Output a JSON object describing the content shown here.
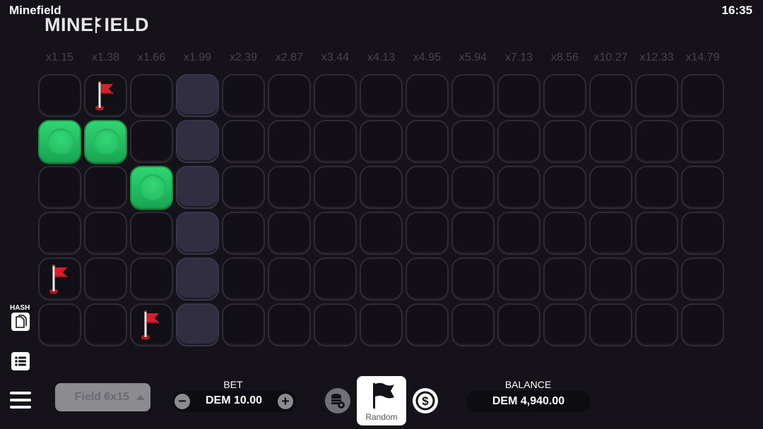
{
  "app": {
    "title": "Minefield",
    "clock": "16:35",
    "logo_left": "MINE",
    "logo_right": "IELD"
  },
  "multipliers": [
    "x1.15",
    "x1.38",
    "x1.66",
    "x1.99",
    "x2.39",
    "x2.87",
    "x3.44",
    "x4.13",
    "x4.95",
    "x5.94",
    "x7.13",
    "x8.56",
    "x10.27",
    "x12.33",
    "x14.79"
  ],
  "grid": {
    "rows": 6,
    "cols": 15,
    "active_column": 3,
    "cells": [
      {
        "row": 1,
        "col": 0,
        "state": "safe"
      },
      {
        "row": 4,
        "col": 0,
        "state": "flag"
      },
      {
        "row": 0,
        "col": 1,
        "state": "flag"
      },
      {
        "row": 1,
        "col": 1,
        "state": "safe"
      },
      {
        "row": 2,
        "col": 2,
        "state": "safe"
      },
      {
        "row": 5,
        "col": 2,
        "state": "flag"
      }
    ]
  },
  "sidebar": {
    "hash_label": "HASH",
    "hash_icon": "copy-icon",
    "history_icon": "list-icon",
    "menu_icon": "hamburger-icon"
  },
  "controls": {
    "field_select": "Field 6x15",
    "bet_label": "BET",
    "bet_value": "DEM 10.00",
    "minus": "−",
    "plus": "+",
    "random_label": "Random",
    "balance_label": "BALANCE",
    "balance_value": "DEM 4,940.00"
  },
  "colors": {
    "safe": "#22c15f",
    "flag": "#d4202a",
    "active_column": "#302e40"
  }
}
